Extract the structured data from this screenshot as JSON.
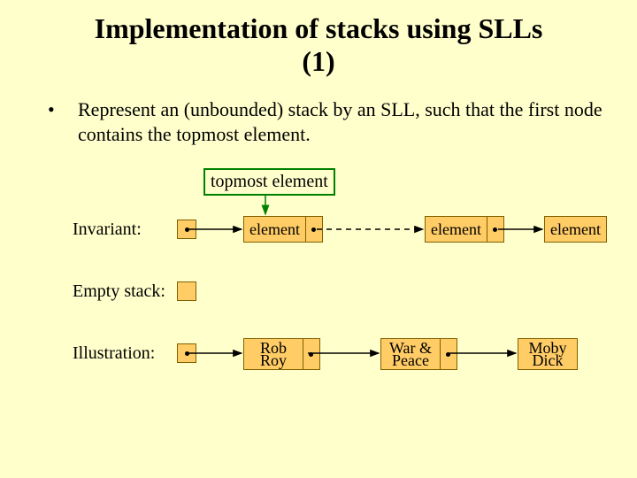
{
  "title_line1": "Implementation of stacks using SLLs",
  "title_line2": "(1)",
  "bullet1": "Represent an (unbounded) stack by an SLL, such that the first node contains the topmost element.",
  "callout": "topmost element",
  "labels": {
    "invariant": "Invariant:",
    "empty": "Empty stack:",
    "illustration": "Illustration:"
  },
  "invariant_nodes": [
    "element",
    "element",
    "element"
  ],
  "illustration_nodes": [
    {
      "l1": "Rob",
      "l2": "Roy"
    },
    {
      "l1": "War &",
      "l2": "Peace"
    },
    {
      "l1": "Moby",
      "l2": "Dick"
    }
  ]
}
